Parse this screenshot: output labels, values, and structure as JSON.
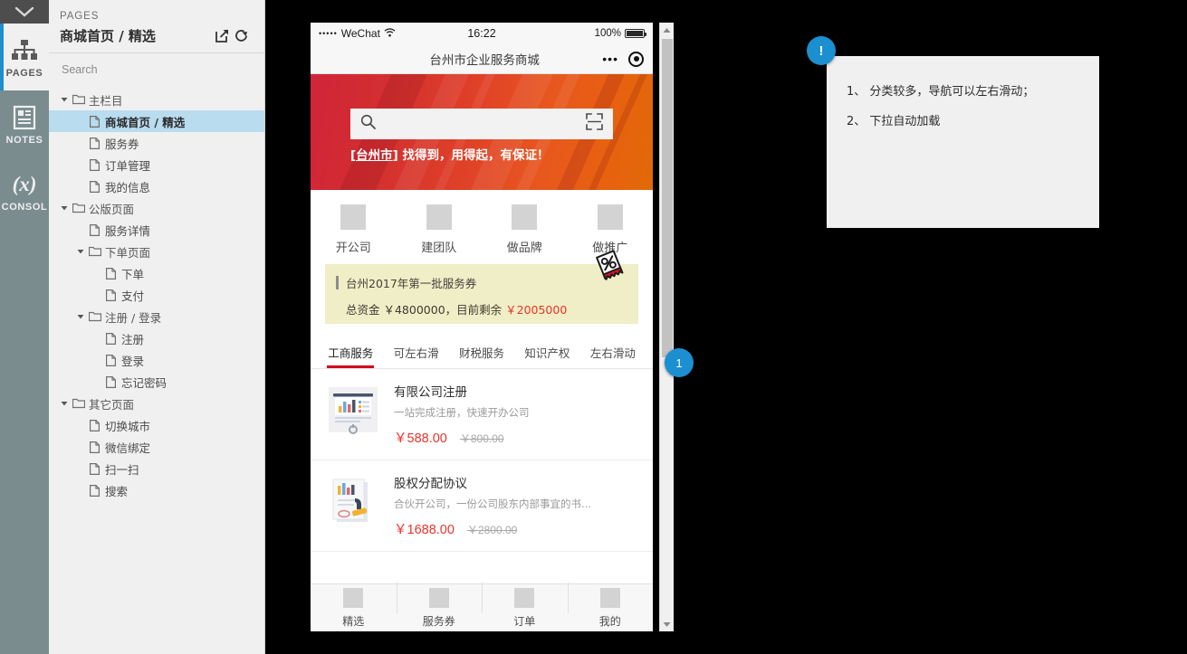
{
  "rail": {
    "collapse_icon": "chevron-down-icon",
    "items": [
      {
        "label": "PAGES",
        "icon": "sitemap-icon",
        "active": true
      },
      {
        "label": "NOTES",
        "icon": "note-icon",
        "active": false
      },
      {
        "label": "CONSOL",
        "icon": "variable-icon",
        "active": false
      }
    ]
  },
  "panel": {
    "kicker": "PAGES",
    "title": "商城首页 / 精选",
    "icons": [
      "open-external-icon",
      "reload-icon"
    ],
    "search": {
      "placeholder": "Search",
      "value": ""
    },
    "tree": [
      {
        "type": "folder",
        "depth": 0,
        "label": "主栏目",
        "expanded": true
      },
      {
        "type": "page",
        "depth": 1,
        "label": "商城首页 / 精选",
        "selected": true
      },
      {
        "type": "page",
        "depth": 1,
        "label": "服务券"
      },
      {
        "type": "page",
        "depth": 1,
        "label": "订单管理"
      },
      {
        "type": "page",
        "depth": 1,
        "label": "我的信息"
      },
      {
        "type": "folder",
        "depth": 0,
        "label": "公版页面",
        "expanded": true
      },
      {
        "type": "page",
        "depth": 1,
        "label": "服务详情"
      },
      {
        "type": "folder",
        "depth": 1,
        "label": "下单页面",
        "expanded": true
      },
      {
        "type": "page",
        "depth": 2,
        "label": "下单"
      },
      {
        "type": "page",
        "depth": 2,
        "label": "支付"
      },
      {
        "type": "folder",
        "depth": 1,
        "label": "注册 / 登录",
        "expanded": true
      },
      {
        "type": "page",
        "depth": 2,
        "label": "注册"
      },
      {
        "type": "page",
        "depth": 2,
        "label": "登录"
      },
      {
        "type": "page",
        "depth": 2,
        "label": "忘记密码"
      },
      {
        "type": "folder",
        "depth": 0,
        "label": "其它页面",
        "expanded": true
      },
      {
        "type": "page",
        "depth": 1,
        "label": "切换城市"
      },
      {
        "type": "page",
        "depth": 1,
        "label": "微信绑定"
      },
      {
        "type": "page",
        "depth": 1,
        "label": "扫一扫"
      },
      {
        "type": "page",
        "depth": 1,
        "label": "搜索"
      }
    ]
  },
  "phone": {
    "statusbar": {
      "signal_dots": "•••••",
      "carrier": "WeChat",
      "wifi_icon": "wifi-icon",
      "time": "16:22",
      "battery_percent": "100%",
      "battery_icon": "battery-full-icon"
    },
    "navbar": {
      "title": "台州市企业服务商城",
      "more_icon": "more-dots-icon",
      "close_icon": "close-circle-icon"
    },
    "hero": {
      "search_icon": "search-icon",
      "scan_icon": "scan-qr-icon",
      "search_placeholder": "",
      "slogan_city": "台州市",
      "slogan_text": "找得到，用得起，有保证！",
      "gradient_from": "#d1243a",
      "gradient_to": "#e06a08"
    },
    "quick_entries": [
      {
        "label": "开公司",
        "icon": "placeholder-icon"
      },
      {
        "label": "建团队",
        "icon": "placeholder-icon"
      },
      {
        "label": "做品牌",
        "icon": "placeholder-icon"
      },
      {
        "label": "做推广",
        "icon": "placeholder-icon"
      }
    ],
    "coupon": {
      "title": "台州2017年第一批服务券",
      "sub_prefix": "总资金 ￥4800000，目前剩余 ",
      "sub_amount": "￥2005000",
      "ticket_icon": "percent-ticket-icon",
      "bg": "#efeec6",
      "amount_color": "#e8342a"
    },
    "tabs": [
      {
        "label": "工商服务",
        "active": true
      },
      {
        "label": "可左右滑",
        "active": false
      },
      {
        "label": "财税服务",
        "active": false
      },
      {
        "label": "知识产权",
        "active": false
      },
      {
        "label": "左右滑动",
        "active": false
      }
    ],
    "tab_underline_color": "#d0021b",
    "products": [
      {
        "thumb_icon": "chart-board-icon",
        "title": "有限公司注册",
        "desc": "一站完成注册，快速开办公司",
        "price": "￥588.00",
        "price_symbol": "￥",
        "price_value": "588.00",
        "old_price": "￥800.00"
      },
      {
        "thumb_icon": "stamp-document-icon",
        "title": "股权分配协议",
        "desc": "合伙开公司，一份公司股东内部事宜的书...",
        "price": "￥1688.00",
        "price_symbol": "￥",
        "price_value": "1688.00",
        "old_price": "￥2800.00"
      }
    ],
    "tabbar": [
      {
        "label": "精选",
        "icon": "placeholder-icon",
        "active": true
      },
      {
        "label": "服务券",
        "icon": "placeholder-icon",
        "active": false
      },
      {
        "label": "订单",
        "icon": "placeholder-icon",
        "active": false
      },
      {
        "label": "我的",
        "icon": "placeholder-icon",
        "active": false
      }
    ]
  },
  "scrollbar": {
    "up_icon": "triangle-up-icon",
    "down_icon": "triangle-down-icon"
  },
  "annotation": {
    "marker_number": "1",
    "badge_glyph": "!",
    "accent_color": "#1b8fd0",
    "lines": [
      "1、 分类较多，导航可以左右滑动；",
      "2、 下拉自动加载"
    ]
  }
}
